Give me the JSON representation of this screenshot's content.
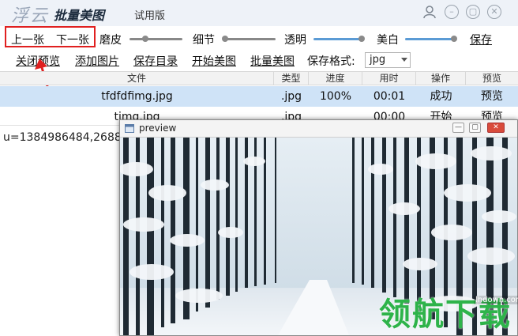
{
  "app": {
    "logo_text": "浮云",
    "title": "批量美图",
    "edition": "试用版"
  },
  "window_controls": {
    "user_icon": "user-icon",
    "minimize_icon": "minimize-icon",
    "maximize_icon": "maximize-icon",
    "close_icon": "close-icon"
  },
  "toolbar1": {
    "prev": "上一张",
    "next": "下一张",
    "smooth_label": "磨皮",
    "smooth_level": 0.3,
    "detail_label": "细节",
    "detail_level": 0.05,
    "transparency_label": "透明",
    "transparency_level": 0.95,
    "whiten_label": "美白",
    "whiten_level": 0.95,
    "save": "保存"
  },
  "toolbar2": {
    "close_preview": "关闭预览",
    "add_image": "添加图片",
    "save_dir": "保存目录",
    "start": "开始美图",
    "batch": "批量美图",
    "format_label": "保存格式:",
    "format_value": "jpg"
  },
  "table": {
    "headers": [
      "文件",
      "类型",
      "进度",
      "用时",
      "操作",
      "预览"
    ],
    "rows": [
      {
        "file": "tfdfdfimg.jpg",
        "type": ".jpg",
        "progress": "100%",
        "time": "00:01",
        "action": "成功",
        "preview": "预览"
      },
      {
        "file": "timg.jpg",
        "type": ".jpg",
        "progress": "",
        "time": "00:00",
        "action": "开始",
        "preview": "预览"
      }
    ]
  },
  "left_panel_text": "u=1384986484,2688",
  "preview_window": {
    "title": "preview",
    "minimize": "—",
    "maximize": "▢",
    "close": "✕"
  },
  "watermark": {
    "text": "领航下载",
    "url": "lhdown.com"
  },
  "colors": {
    "accent": "#5b9bd5",
    "selection": "#cfe3f7",
    "highlight_border": "#e02020",
    "watermark": "#2eb34a"
  }
}
